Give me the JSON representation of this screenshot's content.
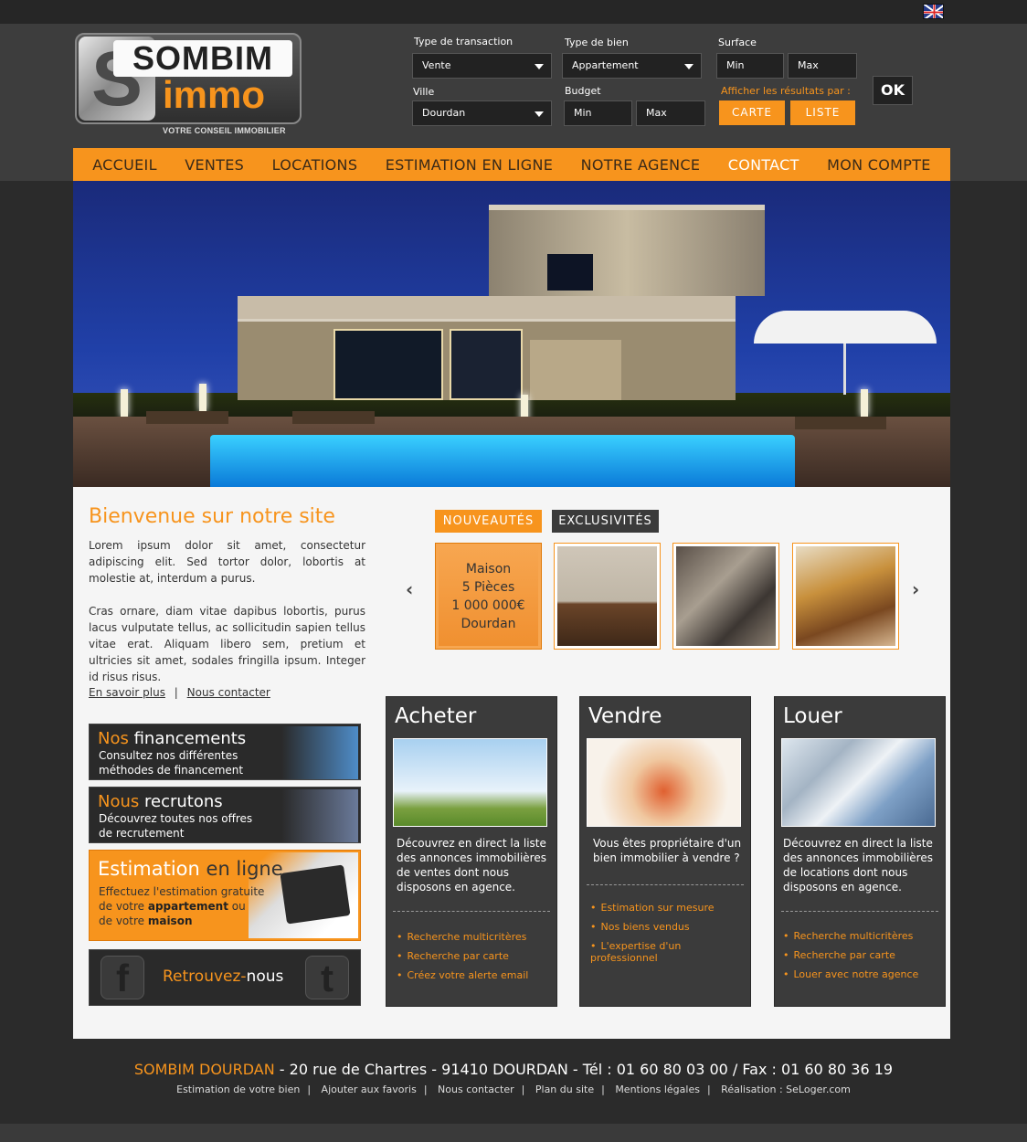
{
  "brand": {
    "logo_top": "SOMBIM",
    "logo_bottom": "immo",
    "tagline": "VOTRE CONSEIL IMMOBILIER"
  },
  "search": {
    "transaction_label": "Type de transaction",
    "transaction_value": "Vente",
    "bien_label": "Type de bien",
    "bien_value": "Appartement",
    "surface_label": "Surface",
    "surface_min": "Min",
    "surface_max": "Max",
    "ville_label": "Ville",
    "ville_value": "Dourdan",
    "budget_label": "Budget",
    "budget_min": "Min",
    "budget_max": "Max",
    "results_label": "Afficher les résultats par :",
    "carte_label": "CARTE",
    "liste_label": "LISTE",
    "ok_label": "OK"
  },
  "nav": {
    "items": [
      "ACCUEIL",
      "VENTES",
      "LOCATIONS",
      "ESTIMATION EN LIGNE",
      "NOTRE AGENCE",
      "CONTACT",
      "MON COMPTE"
    ],
    "active_index": 5
  },
  "welcome": {
    "title": "Bienvenue sur notre site",
    "p1": "Lorem ipsum dolor sit amet, consectetur adipiscing elit. Sed tortor dolor, lobortis at molestie at, interdum a purus.",
    "p2": "Cras ornare, diam vitae dapibus lobortis, purus lacus vulputate tellus, ac sollicitudin sapien tellus vitae erat. Aliquam libero sem, pretium et ultricies sit amet, sodales fringilla ipsum. Integer id risus risus.",
    "link_more": "En savoir plus",
    "link_sep": "|",
    "link_contact": "Nous contacter"
  },
  "panels": {
    "financement_title_a": "Nos",
    "financement_title_b": " financements",
    "financement_text_1": "Consultez nos différentes",
    "financement_text_2": "méthodes de financement",
    "recrutons_title_a": "Nous",
    "recrutons_title_b": " recrutons",
    "recrutons_text_1": "Découvrez toutes nos offres",
    "recrutons_text_2": "de recrutement",
    "estimation_title_a": "Estimation",
    "estimation_title_b": " en ligne",
    "estimation_text_1": "Effectuez l'estimation gratuite",
    "estimation_text_2a": "de votre ",
    "estimation_text_2b": "appartement",
    "estimation_text_2c": " ou",
    "estimation_text_3a": "de votre ",
    "estimation_text_3b": "maison",
    "social_a": "Retrouvez-",
    "social_b": "nous",
    "fb_glyph": "f",
    "tw_glyph": "t"
  },
  "listings": {
    "tab_new": "NOUVEAUTÉS",
    "tab_excl": "EXCLUSIVITÉS",
    "prev": "‹",
    "next": "›",
    "featured": {
      "line1": "Maison",
      "line2": "5 Pièces",
      "line3": "1 000 000€",
      "line4": "Dourdan"
    }
  },
  "cards": [
    {
      "title": "Acheter",
      "text": "Découvrez en direct la liste des annonces immobilières de ventes dont nous disposons en agence.",
      "links": [
        "Recherche multicritères",
        "Recherche par carte",
        "Créez votre alerte email"
      ]
    },
    {
      "title": "Vendre",
      "text": "Vous êtes propriétaire d'un bien immobilier à vendre ?",
      "links": [
        "Estimation sur mesure",
        "Nos biens vendus",
        "L'expertise d'un professionnel"
      ]
    },
    {
      "title": "Louer",
      "text": "Découvrez en direct la liste des annonces immobilières de locations dont nous disposons en agence.",
      "links": [
        "Recherche multicritères",
        "Recherche par carte",
        "Louer avec notre agence"
      ]
    }
  ],
  "footer": {
    "company": "SOMBIM DOURDAN",
    "address": " - 20 rue de Chartres - 91410 DOURDAN - Tél : 01 60 80 03 00 / Fax : 01 60 80 36 19",
    "links": [
      "Estimation de votre bien",
      "Ajouter aux favoris",
      "Nous contacter",
      "Plan du site",
      "Mentions légales",
      "Réalisation : SeLoger.com"
    ]
  },
  "colors": {
    "accent": "#f7941d",
    "header_bg": "#3d3d3d",
    "page_bg": "#2b2b2b"
  }
}
